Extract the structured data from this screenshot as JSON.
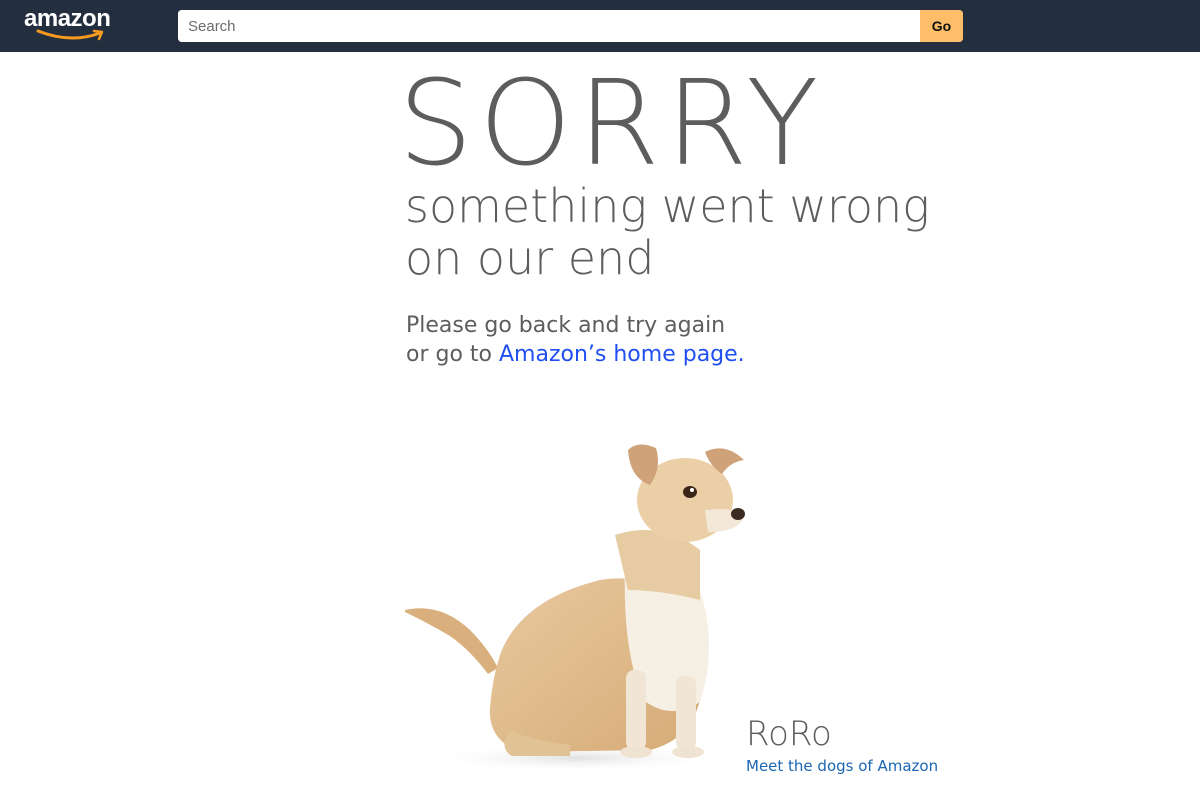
{
  "header": {
    "logo_text": "amazon",
    "logo_smile_color": "#f79a1f",
    "background": "#232f3e",
    "search": {
      "placeholder": "Search",
      "value": ""
    },
    "go_label": "Go",
    "go_color": "#febd69"
  },
  "error": {
    "title": "SORRY",
    "subtitle_line1": "something went wrong",
    "subtitle_line2": "on our end",
    "message_line1": "Please go back and try again",
    "message_line2_prefix": "or go to ",
    "home_link": "Amazon’s home page."
  },
  "dog": {
    "name": "RoRo",
    "link": "Meet the dogs of Amazon",
    "image": "dog-illustration"
  },
  "colors": {
    "text_gray": "#5d5d5d",
    "link_blue": "#1f4ff0",
    "dogs_link_blue": "#1a66b3"
  }
}
